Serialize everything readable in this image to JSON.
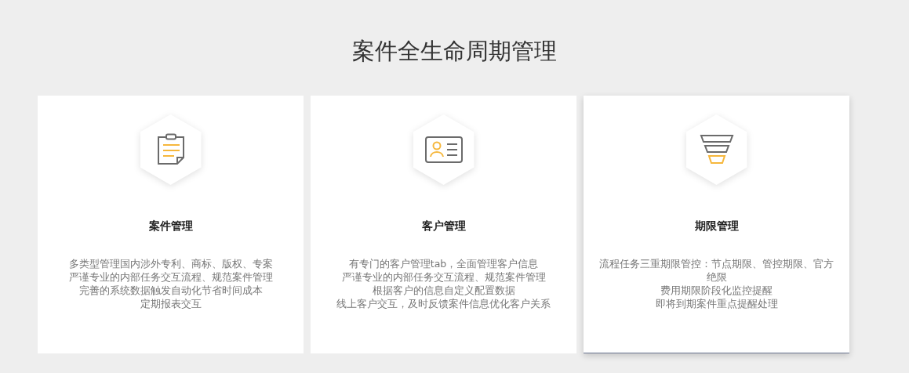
{
  "heading": "案件全生命周期管理",
  "cards": [
    {
      "kind": "clipboard",
      "title": "案件管理",
      "selected": false,
      "lines": [
        "多类型管理国内涉外专利、商标、版权、专案",
        "严谨专业的内部任务交互流程、规范案件管理",
        "完善的系统数据触发自动化节省时间成本",
        "定期报表交互"
      ]
    },
    {
      "kind": "id-card",
      "title": "客户管理",
      "selected": false,
      "lines": [
        "有专门的客户管理tab，全面管理客户信息",
        "严谨专业的内部任务交互流程、规范案件管理",
        "根据客户的信息自定义配置数据",
        "线上客户交互，及时反馈案件信息优化客户关系"
      ]
    },
    {
      "kind": "funnel",
      "title": "期限管理",
      "selected": true,
      "lines": [
        "流程任务三重期限管控：节点期限、管控期限、官方绝限",
        "费用期限阶段化监控提醒",
        "即将到期案件重点提醒处理"
      ]
    }
  ]
}
